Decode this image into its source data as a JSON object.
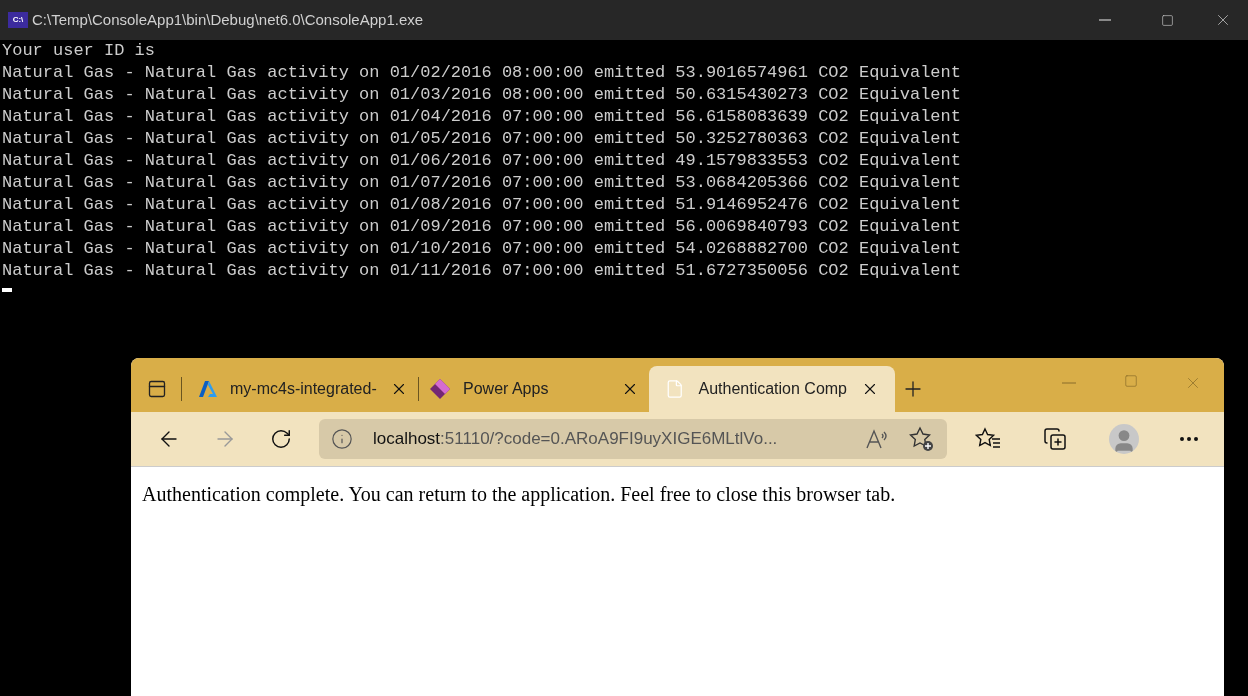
{
  "console": {
    "title": "C:\\Temp\\ConsoleApp1\\bin\\Debug\\net6.0\\ConsoleApp1.exe",
    "icon_text": "C:\\",
    "lines": [
      "Your user ID is",
      "Natural Gas - Natural Gas activity on 01/02/2016 08:00:00 emitted 53.9016574961 CO2 Equivalent",
      "Natural Gas - Natural Gas activity on 01/03/2016 08:00:00 emitted 50.6315430273 CO2 Equivalent",
      "Natural Gas - Natural Gas activity on 01/04/2016 07:00:00 emitted 56.6158083639 CO2 Equivalent",
      "Natural Gas - Natural Gas activity on 01/05/2016 07:00:00 emitted 50.3252780363 CO2 Equivalent",
      "Natural Gas - Natural Gas activity on 01/06/2016 07:00:00 emitted 49.1579833553 CO2 Equivalent",
      "Natural Gas - Natural Gas activity on 01/07/2016 07:00:00 emitted 53.0684205366 CO2 Equivalent",
      "Natural Gas - Natural Gas activity on 01/08/2016 07:00:00 emitted 51.9146952476 CO2 Equivalent",
      "Natural Gas - Natural Gas activity on 01/09/2016 07:00:00 emitted 56.0069840793 CO2 Equivalent",
      "Natural Gas - Natural Gas activity on 01/10/2016 07:00:00 emitted 54.0268882700 CO2 Equivalent",
      "Natural Gas - Natural Gas activity on 01/11/2016 07:00:00 emitted 51.6727350056 CO2 Equivalent"
    ],
    "cursor": true
  },
  "browser": {
    "tabs": [
      {
        "kind": "azure",
        "label": "my-mc4s-integrated-",
        "selected": false
      },
      {
        "kind": "powerapps",
        "label": "Power Apps",
        "selected": false
      },
      {
        "kind": "page",
        "label": "Authentication Comp",
        "selected": true
      }
    ],
    "address": {
      "host": "localhost",
      "rest": ":51110/?code=0.ARoA9FI9uyXIGE6MLtlVo..."
    },
    "page_text": "Authentication complete. You can return to the application. Feel free to close this browser tab."
  }
}
